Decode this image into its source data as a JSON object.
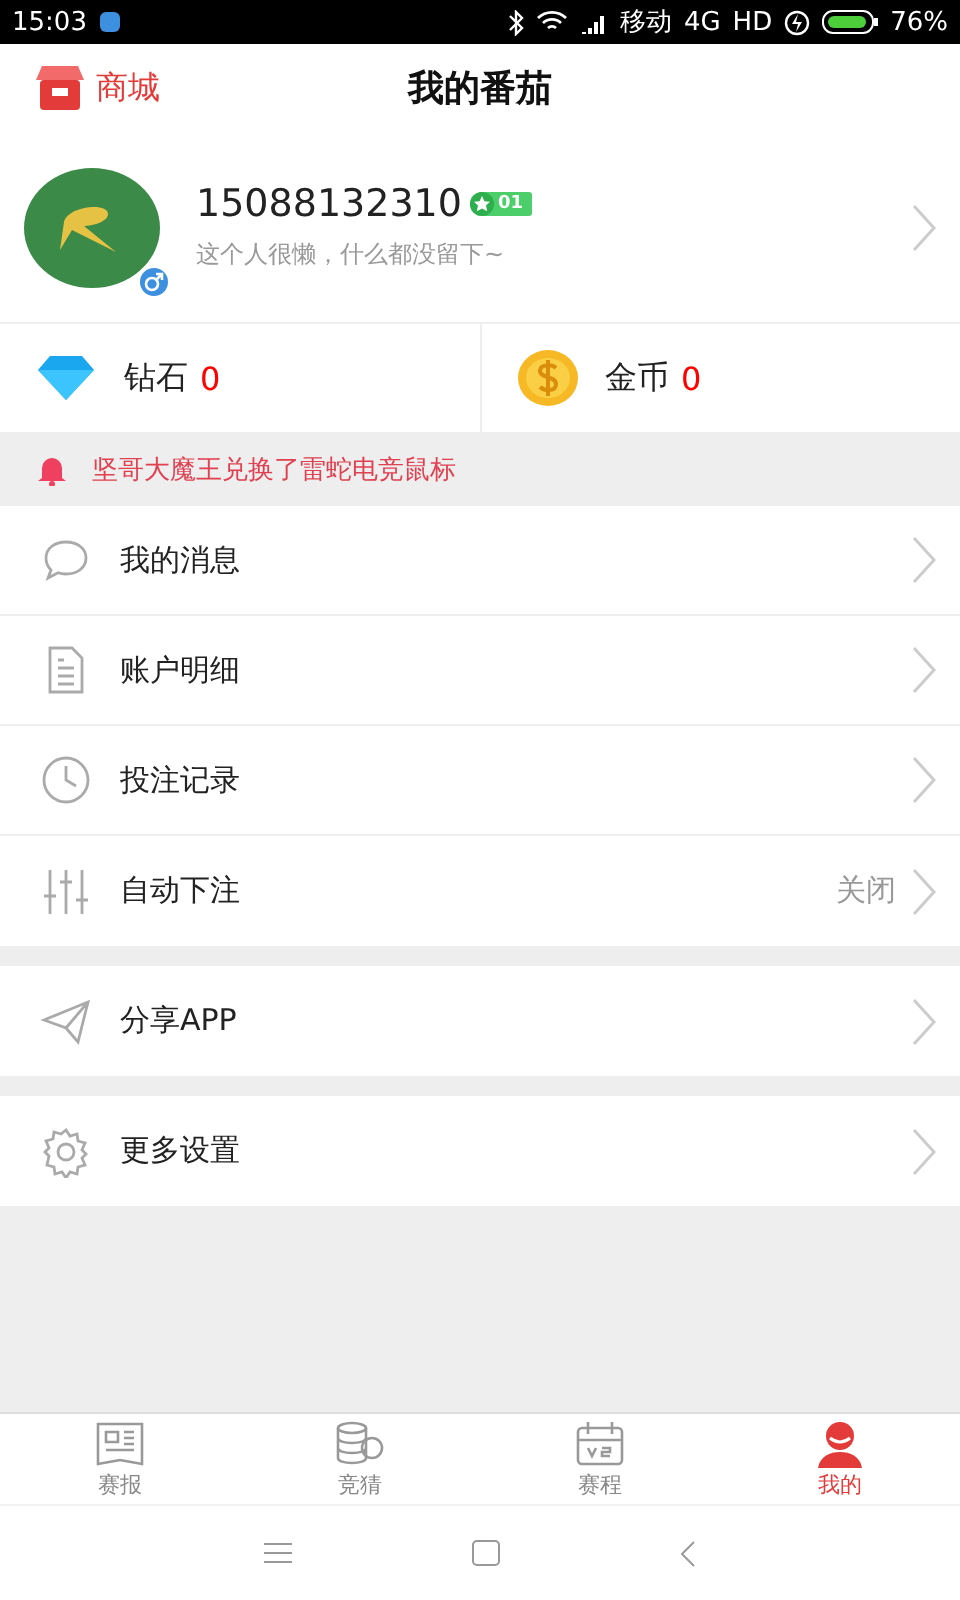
{
  "status_bar": {
    "time": "15:03",
    "carrier": "移动",
    "network": "4G",
    "hd": "HD",
    "battery": "76%"
  },
  "header": {
    "shop": "商城",
    "title": "我的番茄"
  },
  "profile": {
    "phone": "15088132310",
    "level": "01",
    "bio": "这个人很懒，什么都没留下~"
  },
  "wallet": [
    {
      "label": "钻石",
      "value": "0"
    },
    {
      "label": "金币",
      "value": "0"
    }
  ],
  "notice": "坚哥大魔王兑换了雷蛇电竞鼠标",
  "menu_groups": [
    [
      {
        "label": "我的消息"
      },
      {
        "label": "账户明细"
      },
      {
        "label": "投注记录"
      },
      {
        "label": "自动下注",
        "value": "关闭"
      }
    ],
    [
      {
        "label": "分享APP"
      }
    ],
    [
      {
        "label": "更多设置"
      }
    ]
  ],
  "tabs": [
    {
      "label": "赛报",
      "selected": false
    },
    {
      "label": "竞猜",
      "selected": false
    },
    {
      "label": "赛程",
      "selected": false
    },
    {
      "label": "我的",
      "selected": true
    }
  ]
}
